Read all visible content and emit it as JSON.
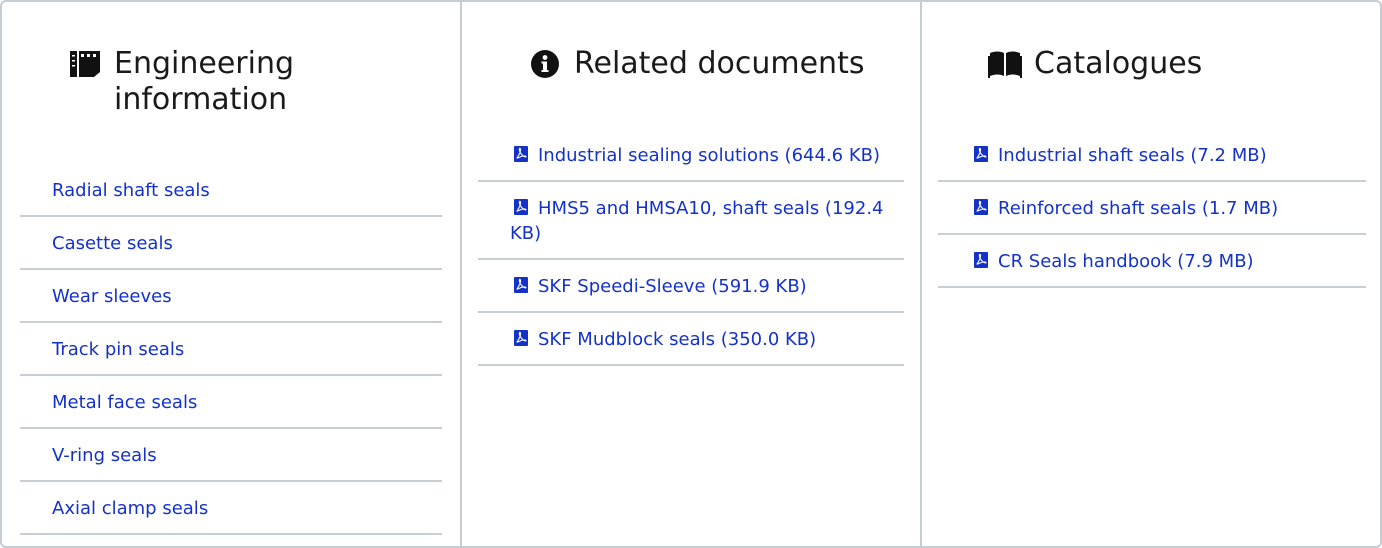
{
  "engineering": {
    "title": "Engineering information",
    "icon": "blueprint-icon",
    "links": [
      "Radial shaft seals",
      "Casette seals",
      "Wear sleeves",
      "Track pin seals",
      "Metal face seals",
      "V-ring seals",
      "Axial clamp seals"
    ]
  },
  "related": {
    "title": "Related documents",
    "icon": "info-circle-icon",
    "links": [
      "Industrial sealing solutions (644.6 KB)",
      "HMS5 and HMSA10, shaft seals (192.4 KB)",
      "SKF Speedi-Sleeve (591.9 KB)",
      "SKF Mudblock seals (350.0 KB)"
    ]
  },
  "catalogues": {
    "title": "Catalogues",
    "icon": "open-book-icon",
    "links": [
      "Industrial shaft seals (7.2 MB)",
      "Reinforced shaft seals (1.7 MB)",
      "CR Seals handbook (7.9 MB)"
    ]
  },
  "colors": {
    "link": "#1432c8",
    "divider": "#c8ced4",
    "text": "#1a1a1a"
  }
}
